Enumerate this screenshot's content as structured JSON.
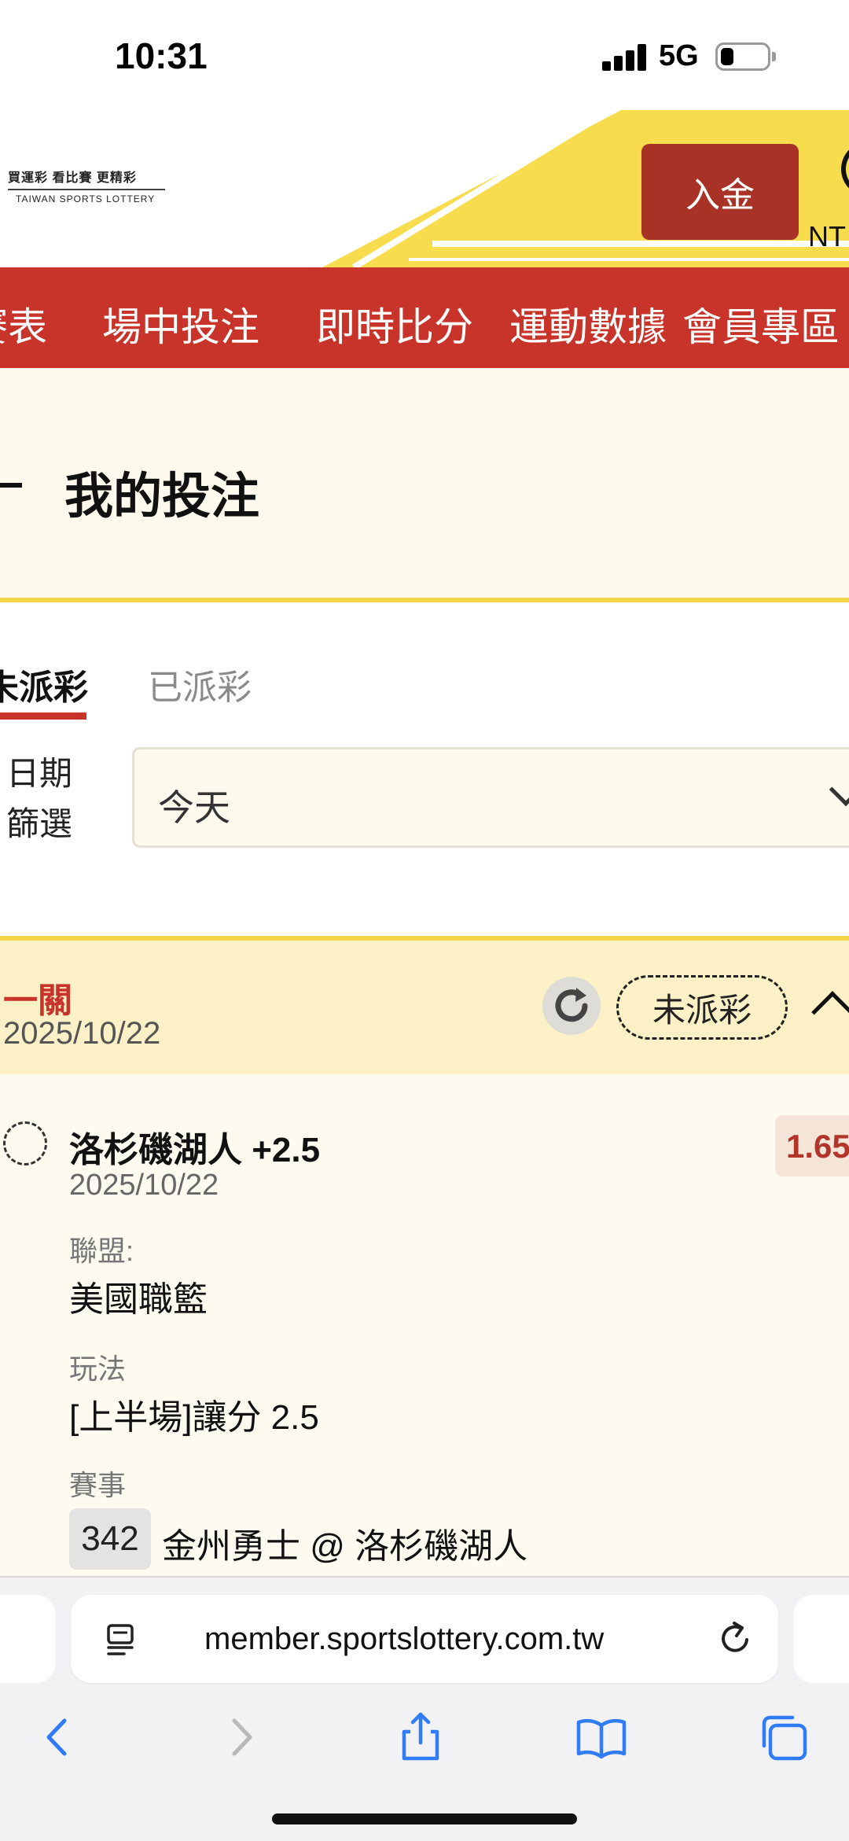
{
  "status_bar": {
    "time": "10:31",
    "network": "5G"
  },
  "header": {
    "logo_cn": "買運彩  看比賽  更精彩",
    "logo_en": "TAIWAN  SPORTS  LOTTERY",
    "deposit_label": "入金",
    "currency_label": "NT"
  },
  "nav": {
    "items": [
      "賽表",
      "場中投注",
      "即時比分",
      "運動數據",
      "會員專區"
    ]
  },
  "page": {
    "title": "我的投注"
  },
  "tabs": {
    "unsettled": "未派彩",
    "settled": "已派彩"
  },
  "filter": {
    "label_line1": "日期",
    "label_line2": "篩選",
    "value": "今天"
  },
  "bet": {
    "type": "一關",
    "date": "2025/10/22",
    "status": "未派彩",
    "selection": "洛杉磯湖人 +2.5",
    "selection_date": "2025/10/22",
    "odds": "1.65",
    "league_label": "聯盟:",
    "league": "美國職籃",
    "play_label": "玩法",
    "play": "[上半場]讓分 2.5",
    "match_label": "賽事",
    "match_no": "342",
    "match": "金州勇士 @ 洛杉磯湖人"
  },
  "browser": {
    "url": "member.sportslottery.com.tw"
  },
  "colors": {
    "brand_red": "#c8332a",
    "deposit_red": "#a83226",
    "accent_yellow": "#f5d649",
    "cream": "#fdf9ec",
    "card_header": "#fcf1c6",
    "odds_text": "#b2352a",
    "ios_blue": "#2f7cf6"
  },
  "icons": {
    "signal": "signal-bars-icon",
    "battery": "battery-icon",
    "refresh": "refresh-icon",
    "collapse": "chevron-up-icon",
    "dropdown": "chevron-down-icon",
    "reader": "reader-mode-icon",
    "reload": "reload-icon",
    "back": "back-icon",
    "forward": "forward-icon",
    "share": "share-icon",
    "bookmarks": "bookmarks-icon",
    "tabs": "tabs-icon"
  }
}
